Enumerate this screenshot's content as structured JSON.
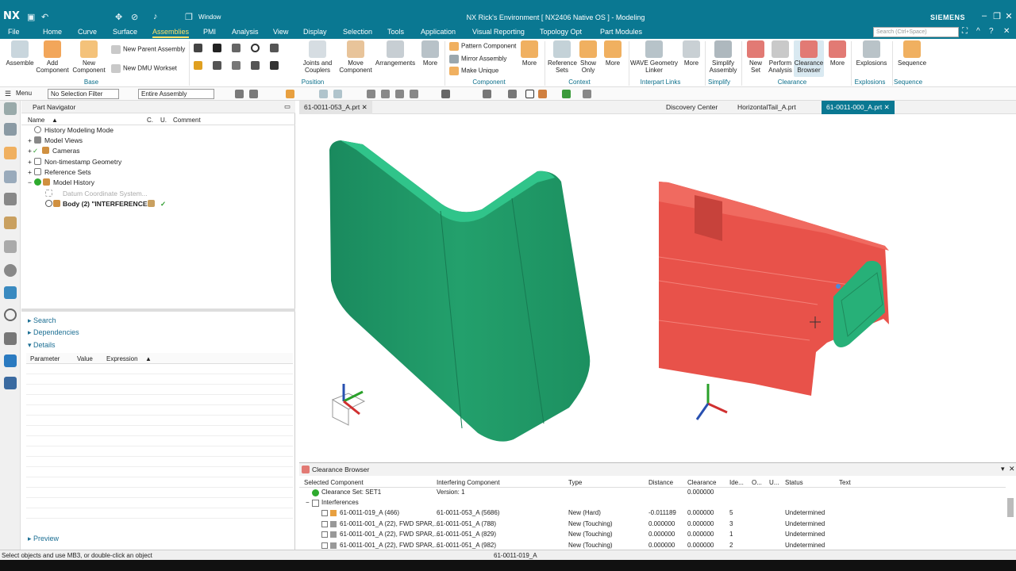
{
  "app": {
    "logo": "NX",
    "title": "NX Rick's Environment [ NX2406 Native OS ] - Modeling",
    "brand": "SIEMENS",
    "window_label": "Window"
  },
  "menu": [
    "File",
    "Home",
    "Curve",
    "Surface",
    "Assemblies",
    "PMI",
    "Analysis",
    "View",
    "Display",
    "Selection",
    "Tools",
    "Application",
    "Visual Reporting",
    "Topology Opt",
    "Part Modules"
  ],
  "active_menu": "Assemblies",
  "search_placeholder": "Search (Ctrl+Space)",
  "ribbon": {
    "assemble": "Assemble",
    "add_component": "Add\nComponent",
    "new_component": "New\nComponent",
    "new_parent": "New Parent Assembly",
    "new_dmu": "New DMU Workset",
    "joints": "Joints and\nCouplers",
    "move_component": "Move\nComponent",
    "arrangements": "Arrangements",
    "more": "More",
    "pattern": "Pattern Component",
    "mirror": "Mirror Assembly",
    "make_unique": "Make Unique",
    "ref_sets": "Reference\nSets",
    "show_only": "Show\nOnly",
    "wave": "WAVE Geometry\nLinker",
    "simplify": "Simplify\nAssembly",
    "new_set": "New\nSet",
    "perform": "Perform\nAnalysis",
    "clearance_browser": "Clearance\nBrowser",
    "explosions": "Explosions",
    "sequence": "Sequence",
    "groups": {
      "base": "Base",
      "position": "Position",
      "component": "Component",
      "context": "Context",
      "interpart": "Interpart Links",
      "simplify": "Simplify",
      "clearance": "Clearance",
      "explosions": "Explosions",
      "sequence": "Sequence"
    }
  },
  "toolbar2": {
    "menu": "Menu",
    "filter": "No Selection Filter",
    "scope": "Entire Assembly"
  },
  "part_navigator": {
    "title": "Part Navigator",
    "columns": [
      "Name",
      "C.",
      "U.",
      "Comment"
    ],
    "rows": [
      "History Modeling Mode",
      "Model Views",
      "Cameras",
      "Non-timestamp Geometry",
      "Reference Sets",
      "Model History",
      "Datum Coordinate System...",
      "Body (2) \"INTERFERENCE..."
    ],
    "sections": {
      "search": "Search",
      "dependencies": "Dependencies",
      "details": "Details",
      "preview": "Preview"
    },
    "detail_columns": [
      "Parameter",
      "Value",
      "Expression"
    ]
  },
  "tabs": [
    "61-0011-053_A.prt",
    "Discovery Center",
    "HorizontalTail_A.prt",
    "61-0011-000_A.prt"
  ],
  "clearance_browser": {
    "title": "Clearance Browser",
    "columns": [
      "Selected Component",
      "Interfering Component",
      "Type",
      "Distance",
      "Clearance",
      "Ide...",
      "O...",
      "U...",
      "Status",
      "Text"
    ],
    "set_row": {
      "sel": "Clearance Set: SET1",
      "intf": "Version: 1",
      "clearance": "0.000000"
    },
    "group": "Interferences",
    "rows": [
      {
        "sel": "61-0011-019_A (466)",
        "intf": "61-0011-053_A (5686)",
        "type": "New (Hard)",
        "dist": "-0.011189",
        "clr": "0.000000",
        "id": "5",
        "status": "Undetermined"
      },
      {
        "sel": "61-0011-001_A (22), FWD SPAR,...",
        "intf": "61-0011-051_A (788)",
        "type": "New (Touching)",
        "dist": "0.000000",
        "clr": "0.000000",
        "id": "3",
        "status": "Undetermined"
      },
      {
        "sel": "61-0011-001_A (22), FWD SPAR,...",
        "intf": "61-0011-051_A (829)",
        "type": "New (Touching)",
        "dist": "0.000000",
        "clr": "0.000000",
        "id": "1",
        "status": "Undetermined"
      },
      {
        "sel": "61-0011-001_A (22), FWD SPAR,...",
        "intf": "61-0011-051_A (982)",
        "type": "New (Touching)",
        "dist": "0.000000",
        "clr": "0.000000",
        "id": "2",
        "status": "Undetermined"
      }
    ]
  },
  "status": {
    "left": "Select objects and use MB3, or double-click an object",
    "center": "61-0011-019_A"
  },
  "colors": {
    "teal": "#0a7892",
    "green_part": "#1f9e6e",
    "red_part": "#e8524a"
  }
}
